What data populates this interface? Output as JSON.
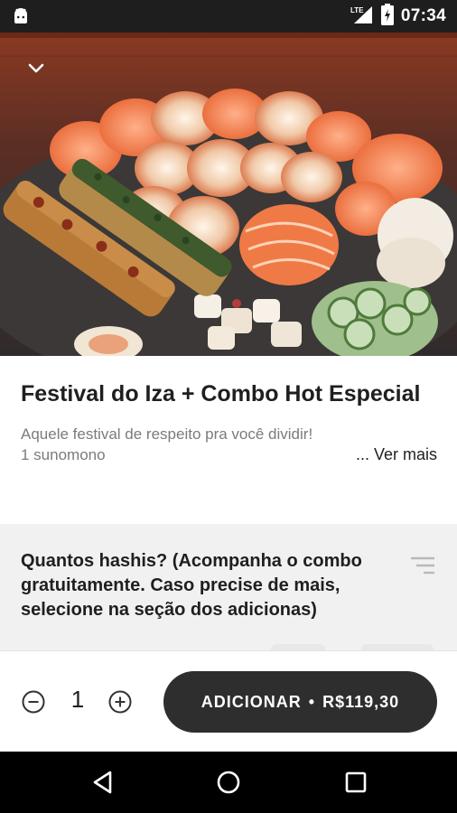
{
  "status_bar": {
    "time": "07:34",
    "network": "LTE",
    "icons": [
      "android-icon",
      "lte-signal-icon",
      "battery-charging-icon"
    ]
  },
  "hero": {
    "image": "sushi-platter-photo",
    "collapse_icon": "chevron-down-icon"
  },
  "product": {
    "title": "Festival do Iza + Combo Hot Especial",
    "description_line1": "Aquele festival de respeito pra você dividir!",
    "description_line2": "1 sunomono",
    "see_more_label": "... Ver mais"
  },
  "options": {
    "question": "Quantos hashis? (Acompanha o combo gratuitamente. Caso precise de mais, selecione na seção dos adicionas)",
    "icon": "filter-list-icon"
  },
  "cart": {
    "quantity": "1",
    "minus_icon": "minus-circle-icon",
    "plus_icon": "plus-circle-icon",
    "add_label": "ADICIONAR",
    "separator": "•",
    "price": "R$119,30"
  },
  "nav_bar": {
    "icons": [
      "back-icon",
      "home-icon",
      "recents-icon"
    ]
  },
  "colors": {
    "status_bar": "#1e1e1e",
    "button": "#2e2e2e",
    "options_bg": "#f1f1f1",
    "nav_bar": "#000000"
  }
}
